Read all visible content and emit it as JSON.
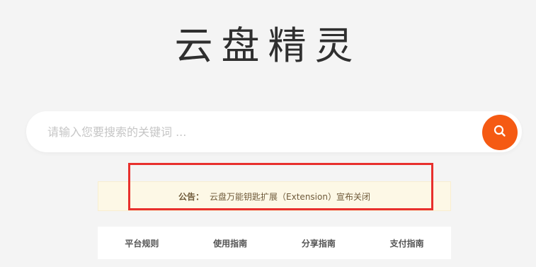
{
  "logo": {
    "text": "云盘精灵"
  },
  "search": {
    "placeholder": "请输入您要搜索的关键词 ..."
  },
  "notice": {
    "label": "公告：",
    "text": "云盘万能钥匙扩展（Extension）宣布关闭"
  },
  "nav": {
    "items": [
      {
        "label": "平台规则"
      },
      {
        "label": "使用指南"
      },
      {
        "label": "分享指南"
      },
      {
        "label": "支付指南"
      }
    ]
  },
  "colors": {
    "accent": "#f55a13",
    "highlight": "#e8302d",
    "notice_bg": "#fdf8e6",
    "page_bg": "#f4f4f4"
  },
  "icons": {
    "search_button": "search-icon"
  }
}
